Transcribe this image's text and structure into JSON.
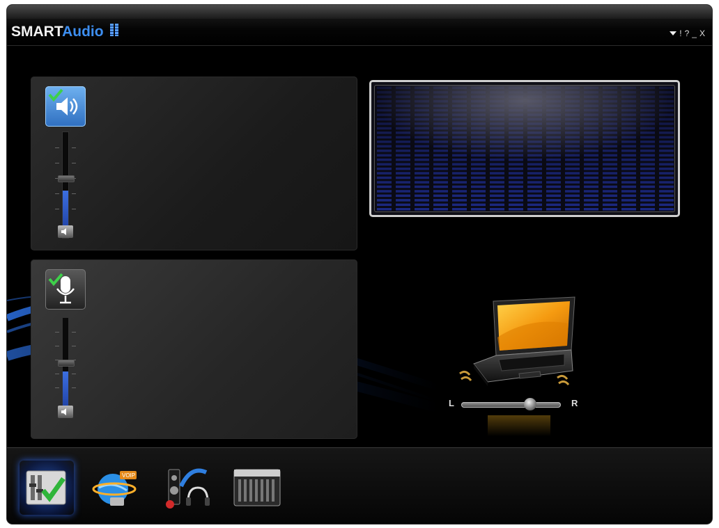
{
  "app": {
    "title_part1": "SMART",
    "title_part2": "Audio"
  },
  "window_controls": {
    "menu": "menu-arrow",
    "info": "!",
    "help": "?",
    "minimize": "_",
    "close": "X"
  },
  "speaker_panel": {
    "icon": "speaker-icon",
    "volume_fraction": 0.45
  },
  "mic_panel": {
    "icon": "microphone-icon",
    "volume_fraction": 0.45
  },
  "balance": {
    "left_label": "L",
    "right_label": "R",
    "value_fraction": 0.72
  },
  "tabs": [
    {
      "name": "mixer-tab",
      "icon": "mixer-check-icon",
      "active": true
    },
    {
      "name": "voip-tab",
      "icon": "globe-voip-icon",
      "active": false
    },
    {
      "name": "audio-director-tab",
      "icon": "speaker-headphones-icon",
      "active": false
    },
    {
      "name": "equalizer-tab",
      "icon": "equalizer-icon",
      "active": false
    }
  ],
  "colors": {
    "accent": "#3d8ef0",
    "background": "#000000",
    "eq_bars": "#1d2b8a"
  }
}
